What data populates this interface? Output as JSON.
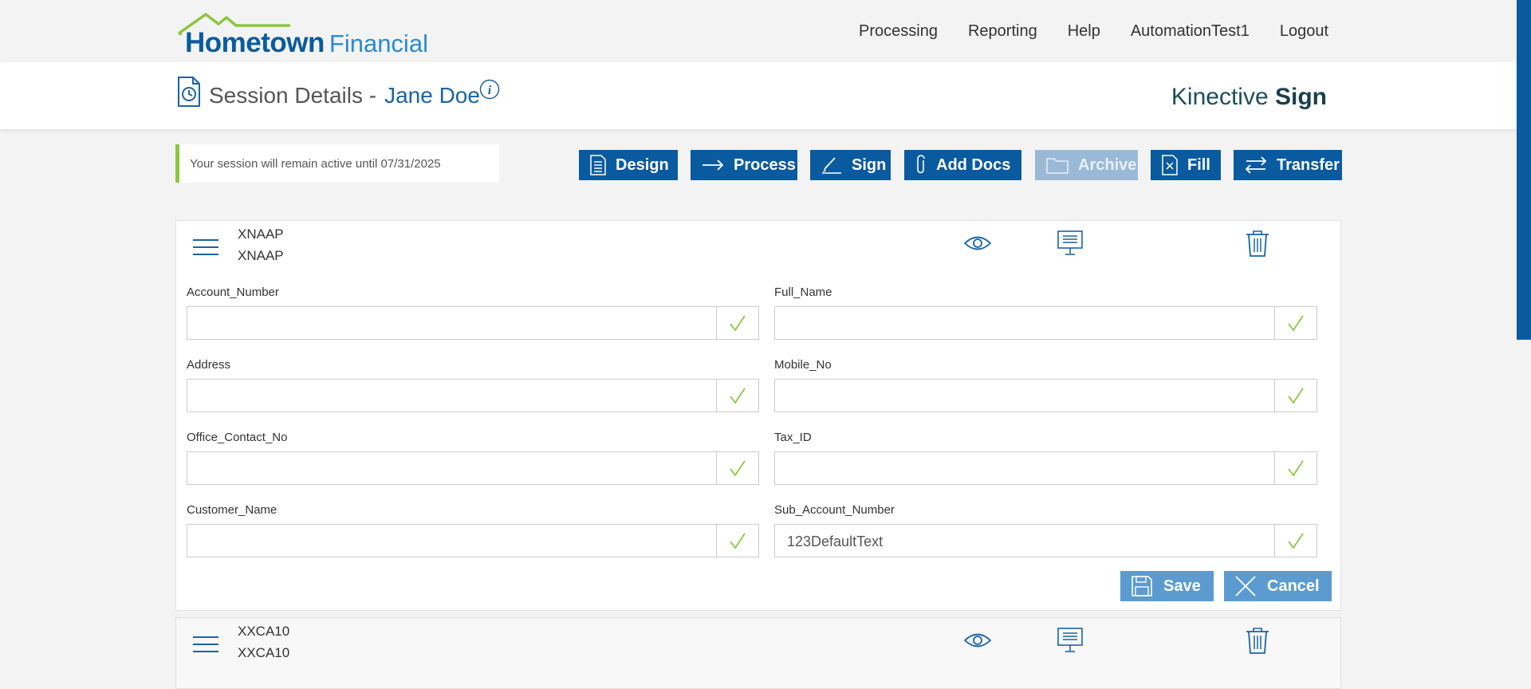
{
  "header": {
    "logo": {
      "part1": "Hometown",
      "part2": "Financial"
    },
    "nav": [
      "Processing",
      "Reporting",
      "Help",
      "AutomationTest1",
      "Logout"
    ]
  },
  "session": {
    "title": "Session Details -",
    "name": "Jane Doe",
    "brand_light": "Kinective",
    "brand_bold": "Sign",
    "notice": "Your session will remain active until 07/31/2025"
  },
  "toolbar": {
    "design": "Design",
    "process": "Process",
    "sign": "Sign",
    "add_docs": "Add Docs",
    "archive": "Archive",
    "fill": "Fill",
    "transfer": "Transfer"
  },
  "doc1": {
    "line1": "XNAAP",
    "line2": "XNAAP",
    "fields": [
      {
        "label": "Account_Number",
        "value": ""
      },
      {
        "label": "Full_Name",
        "value": ""
      },
      {
        "label": "Address",
        "value": ""
      },
      {
        "label": "Mobile_No",
        "value": ""
      },
      {
        "label": "Office_Contact_No",
        "value": ""
      },
      {
        "label": "Tax_ID",
        "value": ""
      },
      {
        "label": "Customer_Name",
        "value": ""
      },
      {
        "label": "Sub_Account_Number",
        "value": "123DefaultText"
      }
    ],
    "save": "Save",
    "cancel": "Cancel"
  },
  "doc2": {
    "line1": "XXCA10",
    "line2": "XXCA10"
  },
  "colors": {
    "primary": "#0a5aa0",
    "accent_green": "#8dc63f",
    "disabled": "#9ab9d6",
    "action": "#5b9bd0"
  }
}
